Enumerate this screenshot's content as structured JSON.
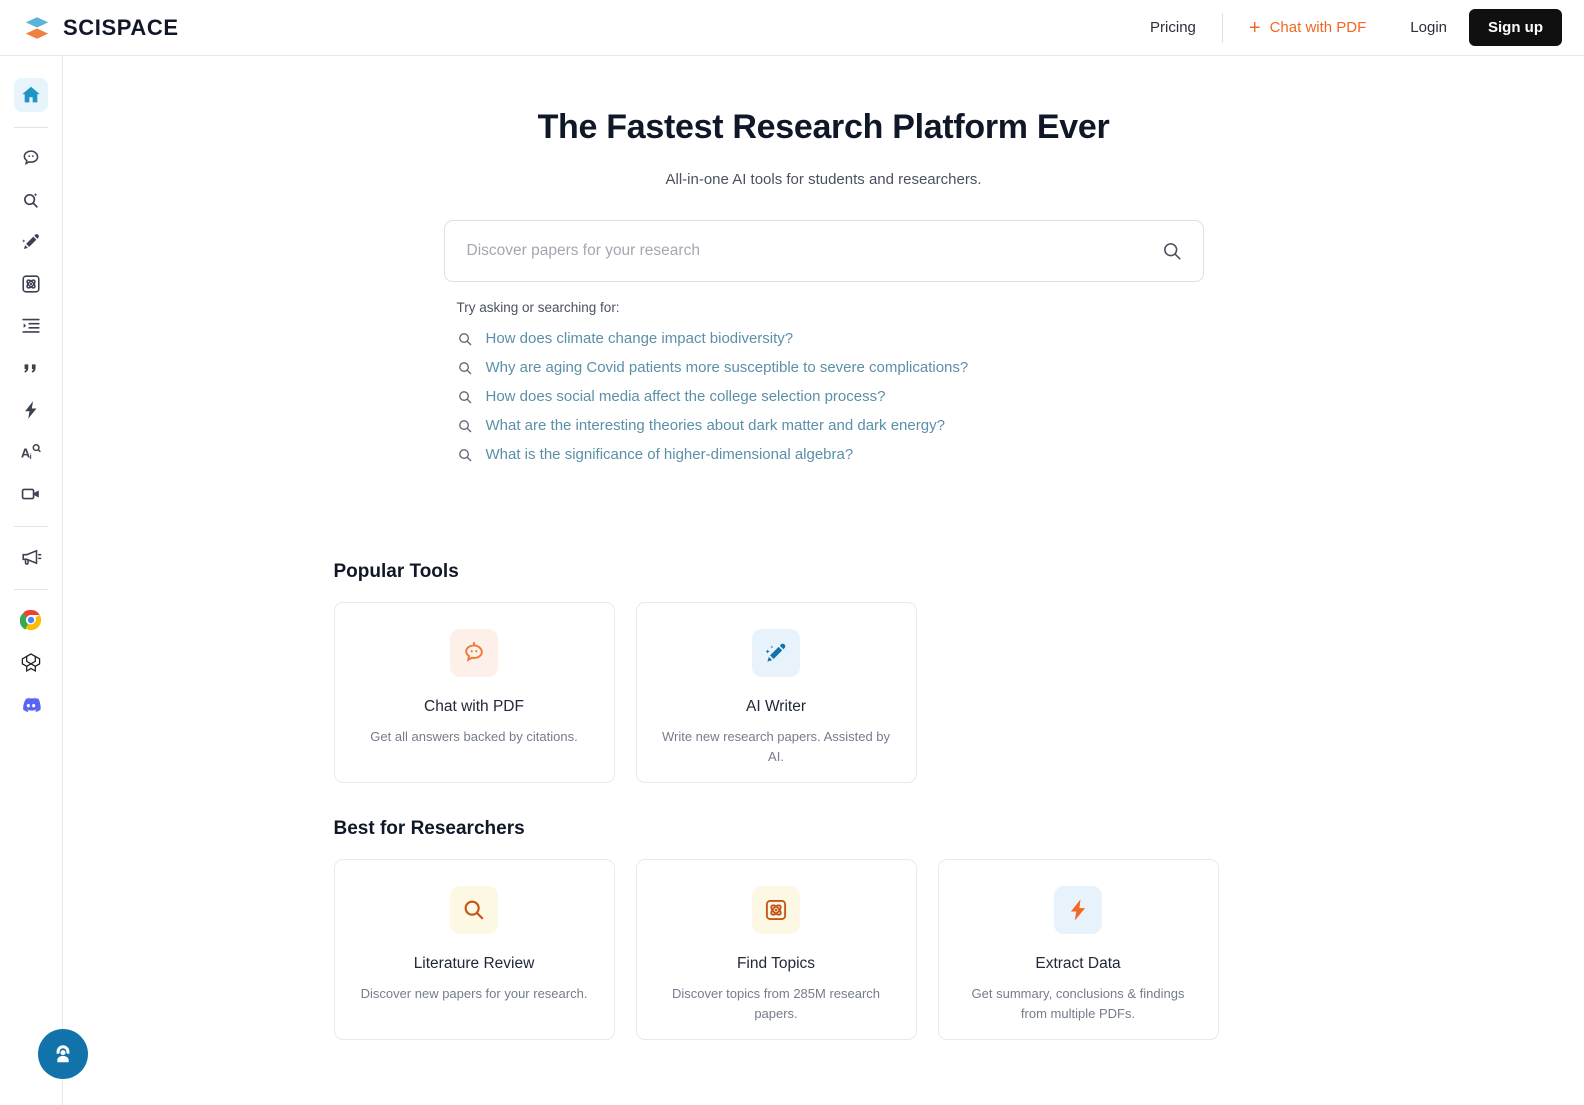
{
  "header": {
    "logo_text": "SCISPACE",
    "logo_icon": "scispace-stacked-layers-logo",
    "pricing_label": "Pricing",
    "chat_with_pdf_label": "Chat with PDF",
    "chat_plus_icon": "plus-icon",
    "login_label": "Login",
    "signup_label": "Sign up",
    "accent_color": "#f26722",
    "signup_bg": "#101010"
  },
  "sidebar": {
    "items": [
      {
        "name": "home",
        "icon": "home-icon",
        "active": true
      },
      {
        "name": "chat-pdf",
        "icon": "chat-bubble-icon",
        "active": false
      },
      {
        "name": "literature-review",
        "icon": "search-sparkle-icon",
        "active": false
      },
      {
        "name": "ai-writer",
        "icon": "magic-pen-icon",
        "active": false
      },
      {
        "name": "find-topics",
        "icon": "atom-icon",
        "active": false
      },
      {
        "name": "extract-data",
        "icon": "list-indent-icon",
        "active": false
      },
      {
        "name": "citations",
        "icon": "quote-icon",
        "active": false
      },
      {
        "name": "quick-actions",
        "icon": "lightning-bolt-icon",
        "active": false
      },
      {
        "name": "paraphraser",
        "icon": "text-ai-icon",
        "active": false
      },
      {
        "name": "video",
        "icon": "video-camera-icon",
        "active": false
      },
      {
        "name": "announcements",
        "icon": "megaphone-icon",
        "active": false
      },
      {
        "name": "chrome-extension",
        "icon": "chrome-icon",
        "active": false
      },
      {
        "name": "openai",
        "icon": "openai-icon",
        "active": false
      },
      {
        "name": "discord",
        "icon": "discord-icon",
        "active": false
      }
    ],
    "active_bg": "#e7f4fb",
    "active_color": "#1f95c4"
  },
  "hero": {
    "title": "The Fastest Research Platform Ever",
    "subtitle": "All-in-one AI tools for students and researchers."
  },
  "search": {
    "value": "",
    "placeholder": "Discover papers for your research",
    "icon": "search-icon"
  },
  "suggestions": {
    "label": "Try asking or searching for:",
    "icon": "search-icon",
    "items": [
      "How does climate change impact biodiversity?",
      "Why are aging Covid patients more susceptible to severe complications?",
      "How does social media affect the college selection process?",
      "What are the interesting theories about dark matter and dark energy?",
      "What is the significance of higher-dimensional algebra?"
    ]
  },
  "popular_tools": {
    "title": "Popular Tools",
    "cards": [
      {
        "title": "Chat with PDF",
        "desc": "Get all answers backed by citations.",
        "icon": "chat-bot-bubble-icon",
        "icon_bg": "#fdf0e8",
        "icon_color": "#ef7a3c"
      },
      {
        "title": "AI Writer",
        "desc": "Write new research papers. Assisted by AI.",
        "icon": "magic-pen-icon",
        "icon_bg": "#e8f2fa",
        "icon_color": "#1273ab"
      }
    ]
  },
  "best_for_researchers": {
    "title": "Best for Researchers",
    "cards": [
      {
        "title": "Literature Review",
        "desc": "Discover new papers for your research.",
        "icon": "search-icon",
        "icon_bg": "#fdf8e3",
        "icon_color": "#c4561a"
      },
      {
        "title": "Find Topics",
        "desc": "Discover topics from 285M research papers.",
        "icon": "atom-icon",
        "icon_bg": "#fdf8e3",
        "icon_color": "#c4561a"
      },
      {
        "title": "Extract Data",
        "desc": "Get summary, conclusions & findings from multiple PDFs.",
        "icon": "lightning-bolt-icon",
        "icon_bg": "#e8f2fa",
        "icon_color": "#f26722"
      }
    ]
  },
  "support_fab": {
    "icon": "support-agent-icon",
    "color": "#1273ab"
  }
}
